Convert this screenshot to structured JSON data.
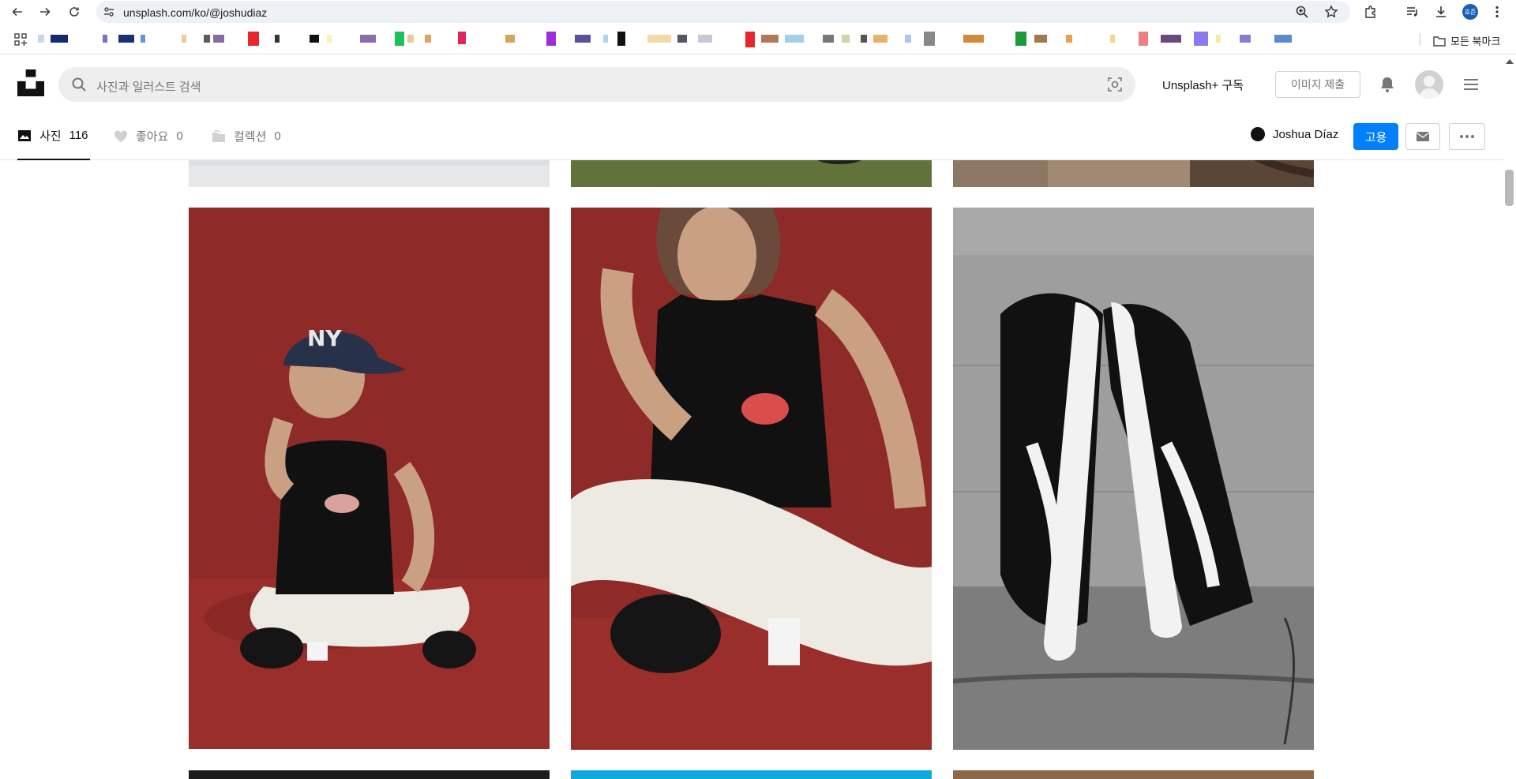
{
  "browser": {
    "url": "unsplash.com/ko/@joshudiaz",
    "bookmarks_folder_label": "모든 북마크",
    "profile_initials": "호준"
  },
  "header": {
    "search_placeholder": "사진과 일러스트 검색",
    "plus_link": "Unsplash+ 구독",
    "submit_button": "이미지 제출"
  },
  "profile_tabs": [
    {
      "label": "사진",
      "count": "116",
      "icon": "image-icon",
      "active": true
    },
    {
      "label": "좋아요",
      "count": "0",
      "icon": "heart-icon",
      "active": false
    },
    {
      "label": "컬렉션",
      "count": "0",
      "icon": "folder-icon",
      "active": false
    }
  ],
  "profile_actions": {
    "user_name": "Joshua Díaz",
    "hire_button": "고용"
  },
  "colors": {
    "accent": "#007fff",
    "search_bg": "#eeeeee",
    "text_muted": "#767676",
    "photo_red": "#8e2a27"
  }
}
